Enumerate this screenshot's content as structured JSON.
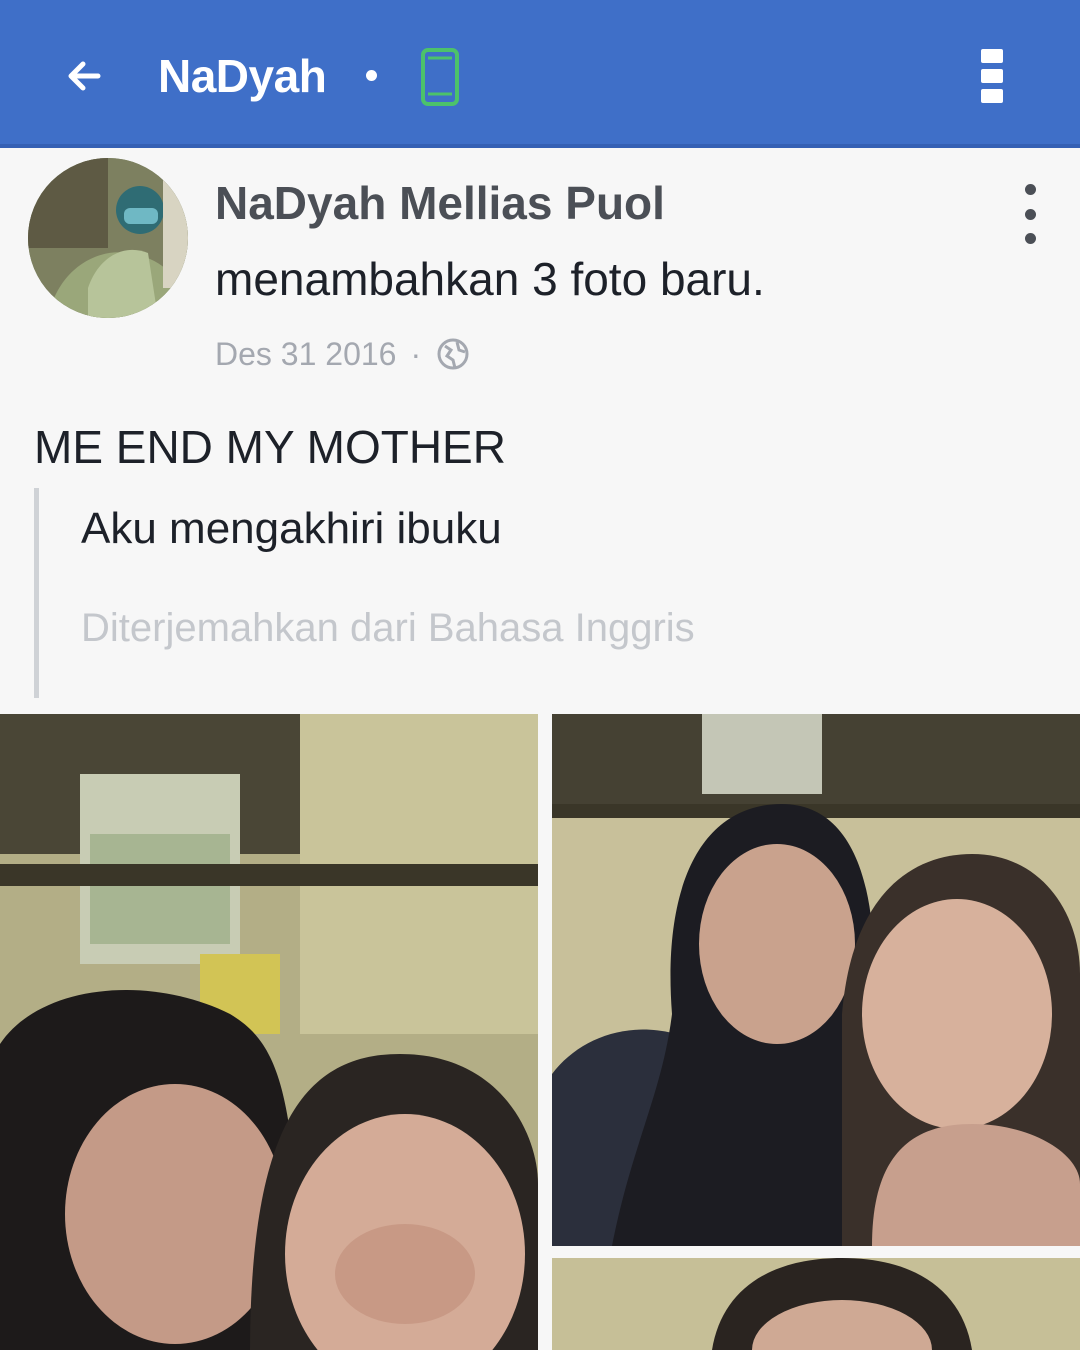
{
  "appbar": {
    "title": "NaDyah",
    "back_icon": "arrow-left-icon",
    "status_icon": "mobile-phone-icon",
    "menu_icon": "more-vertical-icon",
    "color": "#3f6fc8"
  },
  "post": {
    "author": "NaDyah Mellias Puol",
    "action": "menambahkan 3 foto baru.",
    "date": "Des 31 2016",
    "separator": "·",
    "privacy_icon": "globe-icon",
    "text": "ME END MY MOTHER",
    "translation": "Aku mengakhiri ibuku",
    "translated_from": "Diterjemahkan dari Bahasa Inggris",
    "photo_count": 3
  }
}
